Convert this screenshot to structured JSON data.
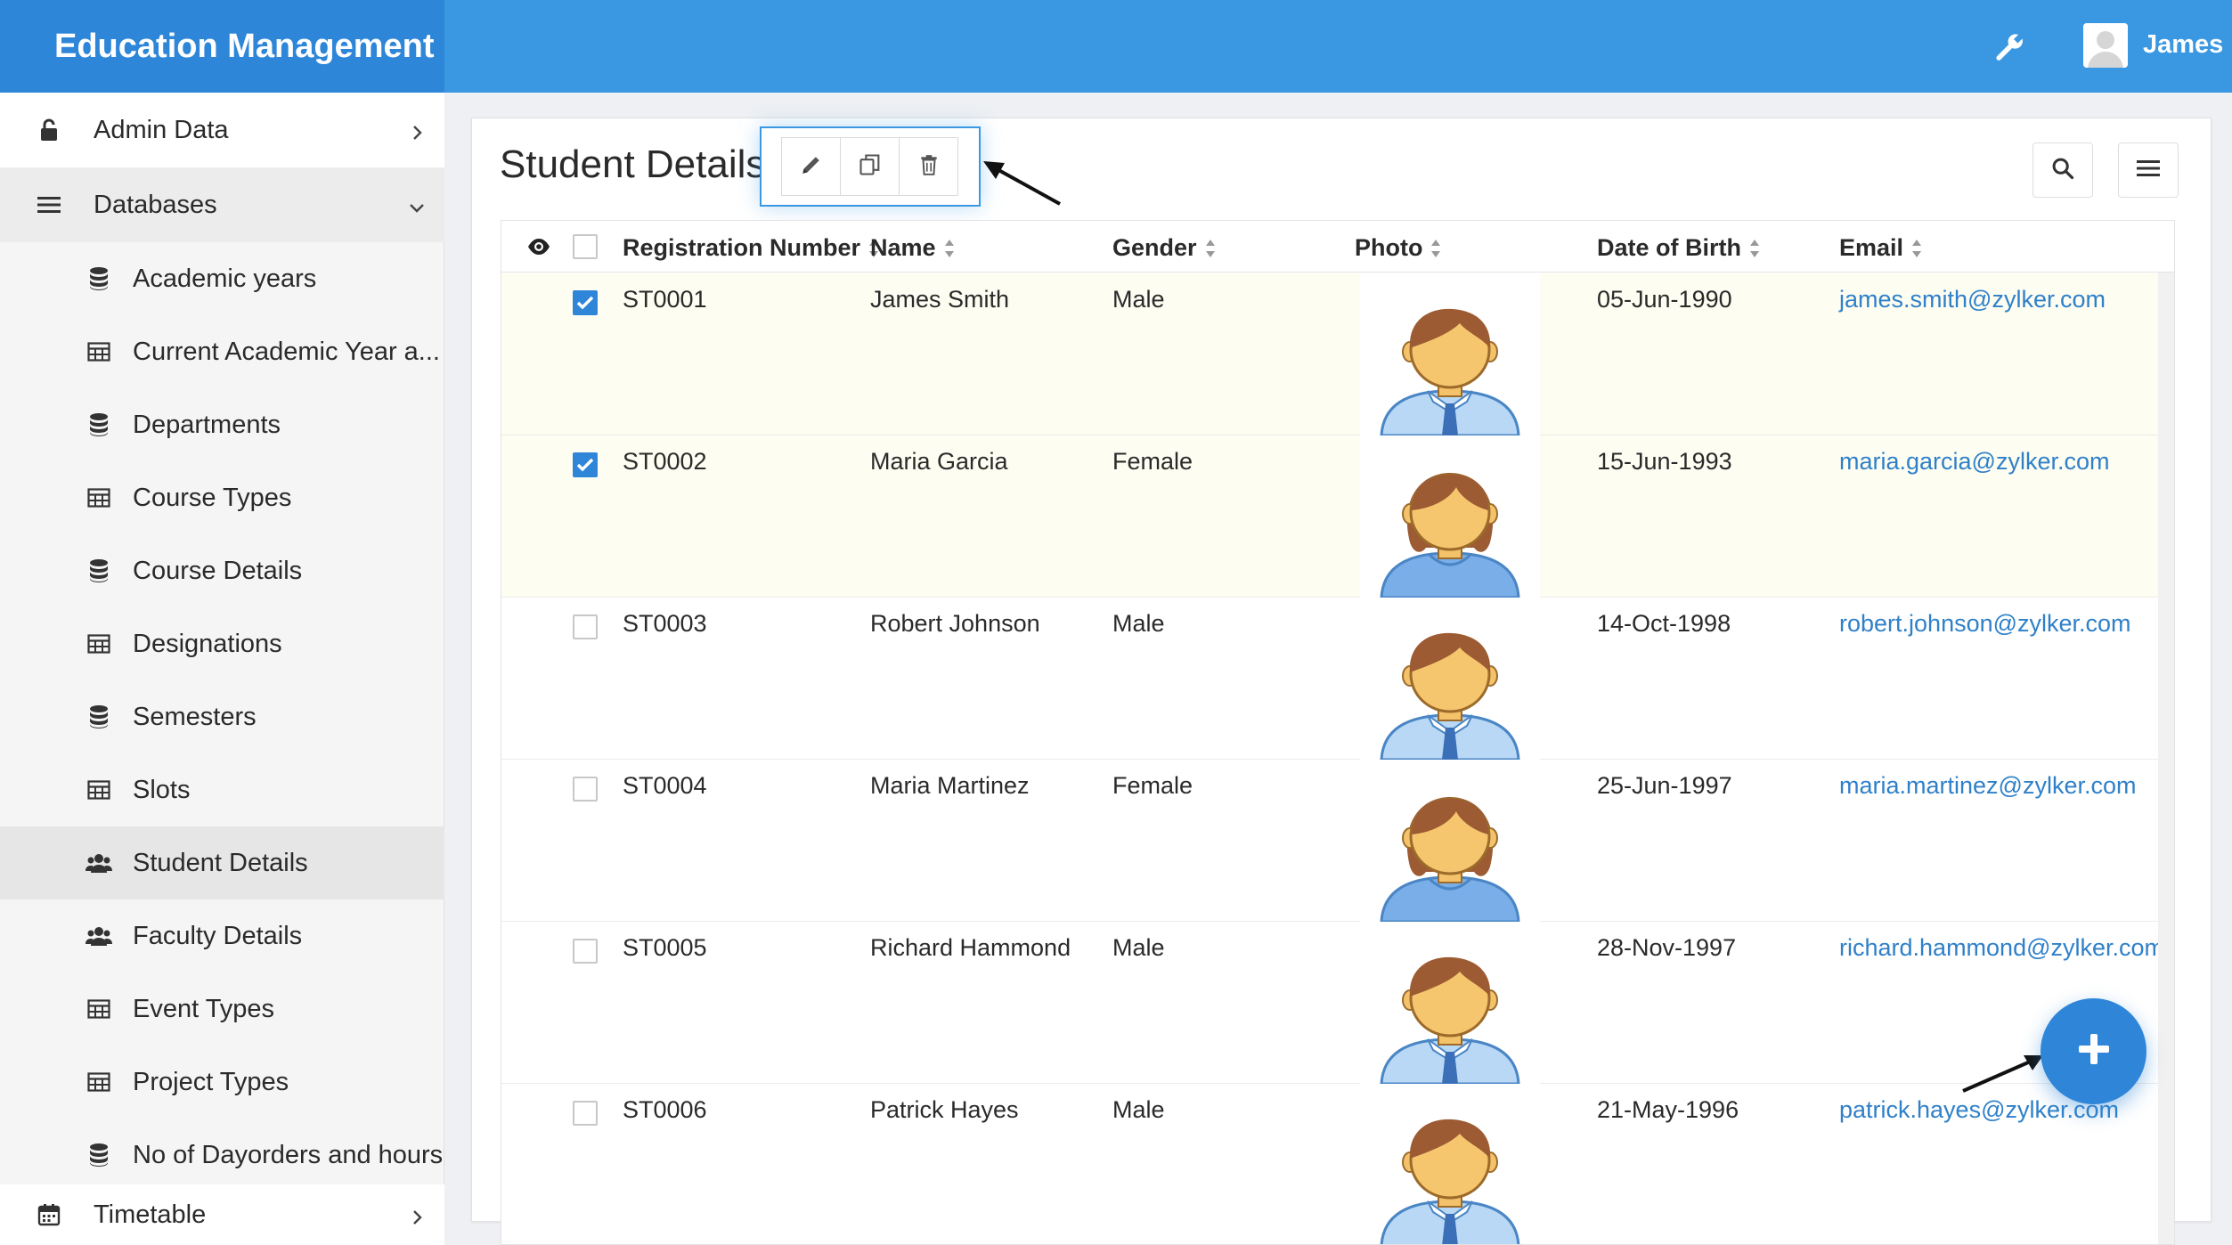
{
  "app": {
    "title": "Education Management",
    "user": "James"
  },
  "sidebar": {
    "admin": "Admin Data",
    "databases": "Databases",
    "items": [
      {
        "label": "Academic years",
        "icon": "database-icon"
      },
      {
        "label": "Current Academic Year a...",
        "icon": "table-icon"
      },
      {
        "label": "Departments",
        "icon": "database-icon"
      },
      {
        "label": "Course Types",
        "icon": "table-icon"
      },
      {
        "label": "Course Details",
        "icon": "database-icon"
      },
      {
        "label": "Designations",
        "icon": "table-icon"
      },
      {
        "label": "Semesters",
        "icon": "database-icon"
      },
      {
        "label": "Slots",
        "icon": "table-icon"
      },
      {
        "label": "Student Details",
        "icon": "users-icon",
        "active": true
      },
      {
        "label": "Faculty Details",
        "icon": "users-icon"
      },
      {
        "label": "Event Types",
        "icon": "table-icon"
      },
      {
        "label": "Project Types",
        "icon": "table-icon"
      },
      {
        "label": "No of Dayorders and hours",
        "icon": "database-icon"
      }
    ],
    "timetable": "Timetable"
  },
  "page": {
    "title": "Student Details"
  },
  "table": {
    "columns": [
      "Registration Number",
      "Name",
      "Gender",
      "Photo",
      "Date of Birth",
      "Email"
    ],
    "rows": [
      {
        "reg": "ST0001",
        "name": "James Smith",
        "gender": "Male",
        "dob": "05-Jun-1990",
        "email": "james.smith@zylker.com",
        "checked": true
      },
      {
        "reg": "ST0002",
        "name": "Maria Garcia",
        "gender": "Female",
        "dob": "15-Jun-1993",
        "email": "maria.garcia@zylker.com",
        "checked": true
      },
      {
        "reg": "ST0003",
        "name": "Robert Johnson",
        "gender": "Male",
        "dob": "14-Oct-1998",
        "email": "robert.johnson@zylker.com",
        "checked": false
      },
      {
        "reg": "ST0004",
        "name": "Maria Martinez",
        "gender": "Female",
        "dob": "25-Jun-1997",
        "email": "maria.martinez@zylker.com",
        "checked": false
      },
      {
        "reg": "ST0005",
        "name": "Richard Hammond",
        "gender": "Male",
        "dob": "28-Nov-1997",
        "email": "richard.hammond@zylker.com",
        "checked": false
      },
      {
        "reg": "ST0006",
        "name": "Patrick Hayes",
        "gender": "Male",
        "dob": "21-May-1996",
        "email": "patrick.hayes@zylker.com",
        "checked": false
      }
    ]
  },
  "colors": {
    "primary": "#2f86d8",
    "topbar": "#3a98e2",
    "brand": "#2e86d8",
    "link": "#2f80c9"
  }
}
